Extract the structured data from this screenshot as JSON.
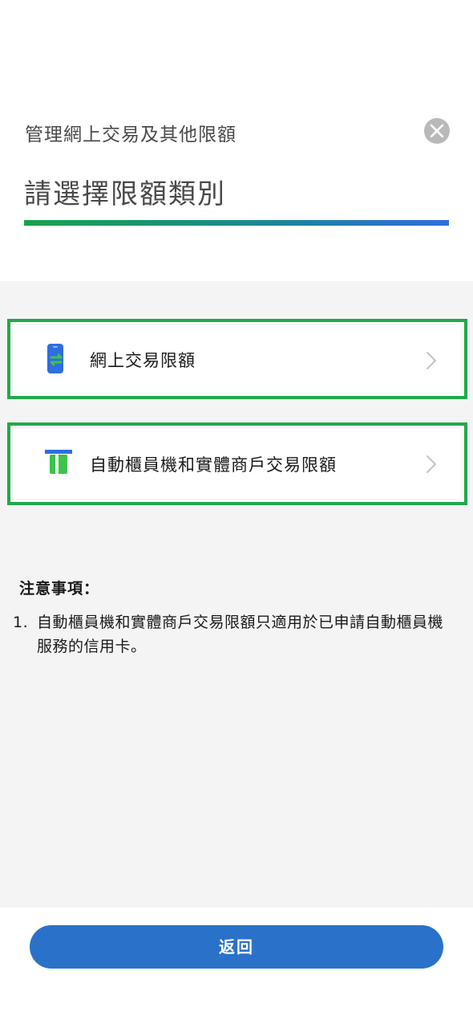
{
  "header": {
    "title": "管理網上交易及其他限額",
    "headline": "請選擇限額類別"
  },
  "options": [
    {
      "label": "網上交易限額",
      "icon": "phone-transfer-icon"
    },
    {
      "label": "自動櫃員機和實體商戶交易限額",
      "icon": "atm-card-icon"
    }
  ],
  "notes": {
    "title": "注意事項：",
    "items": [
      {
        "number": "1.",
        "text": "自動櫃員機和實體商戶交易限額只適用於已申請自動櫃員機服務的信用卡。"
      }
    ]
  },
  "footer": {
    "back_label": "返回"
  },
  "colors": {
    "accent_blue": "#2a72c9",
    "highlight_green": "#22a84a",
    "gradient_start": "#17a34a",
    "gradient_end": "#2f6de1"
  }
}
